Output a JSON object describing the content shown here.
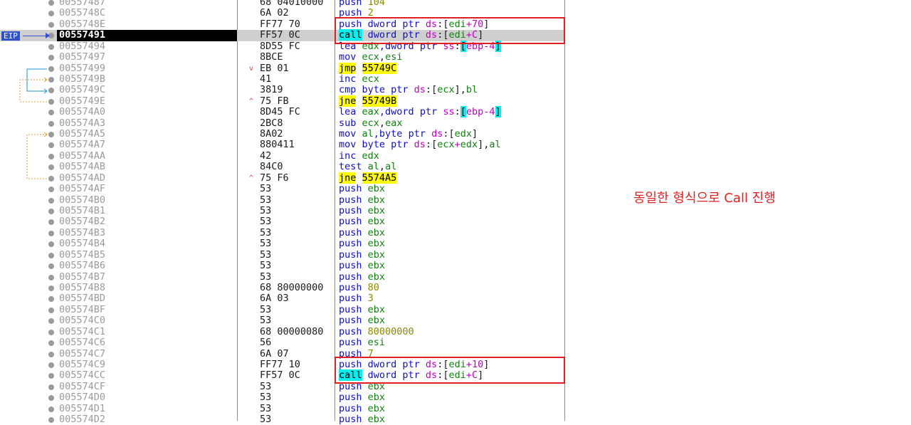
{
  "eip_label": "EIP",
  "note": "동일한 형식으로 Call 진행",
  "colors": {
    "highlight_jump": "#ffff00",
    "highlight_call": "#00f0f0",
    "annotation": "#e02020",
    "eip_marker": "#3050d0"
  },
  "rows": [
    {
      "addr": "00557487",
      "bytes": "68 04010000",
      "mark": "",
      "ins": [
        [
          "push",
          "mn"
        ],
        [
          " ",
          "plain"
        ],
        [
          "104",
          "num"
        ]
      ]
    },
    {
      "addr": "0055748C",
      "bytes": "6A 02",
      "mark": "",
      "ins": [
        [
          "push",
          "mn"
        ],
        [
          " ",
          "plain"
        ],
        [
          "2",
          "num"
        ]
      ]
    },
    {
      "addr": "0055748E",
      "bytes": "FF77 70",
      "mark": "",
      "ins": [
        [
          "push",
          "mn"
        ],
        [
          " dword ptr ",
          "mn"
        ],
        [
          "ds",
          "seg"
        ],
        [
          ":[",
          "plain"
        ],
        [
          "edi",
          "reg"
        ],
        [
          "+70",
          "seg"
        ],
        [
          "]",
          "plain"
        ]
      ]
    },
    {
      "addr": "00557491",
      "bytes": "FF57 0C",
      "mark": "",
      "eip": true,
      "ins": [
        [
          "call",
          "cyan"
        ],
        [
          " dword ptr ",
          "mn"
        ],
        [
          "ds",
          "seg"
        ],
        [
          ":[",
          "plain"
        ],
        [
          "edi",
          "reg"
        ],
        [
          "+C",
          "seg"
        ],
        [
          "]",
          "plain"
        ]
      ]
    },
    {
      "addr": "00557494",
      "bytes": "8D55 FC",
      "mark": "",
      "ins": [
        [
          "lea",
          "mn"
        ],
        [
          " ",
          "plain"
        ],
        [
          "edx",
          "reg"
        ],
        [
          ",dword ptr ",
          "mn"
        ],
        [
          "ss",
          "seg"
        ],
        [
          ":",
          "plain"
        ],
        [
          "[",
          "cyan"
        ],
        [
          "ebp-4",
          "seg"
        ],
        [
          "]",
          "cyan"
        ]
      ]
    },
    {
      "addr": "00557497",
      "bytes": "8BCE",
      "mark": "",
      "ins": [
        [
          "mov",
          "mn"
        ],
        [
          " ",
          "plain"
        ],
        [
          "ecx",
          "reg"
        ],
        [
          ",",
          "plain"
        ],
        [
          "esi",
          "reg"
        ]
      ]
    },
    {
      "addr": "00557499",
      "bytes": "EB 01",
      "mark": "v",
      "ins": [
        [
          "jmp",
          "yellow"
        ],
        [
          " ",
          "plain"
        ],
        [
          "55749C",
          "yellow"
        ]
      ]
    },
    {
      "addr": "0055749B",
      "bytes": "41",
      "mark": "",
      "ins": [
        [
          "inc",
          "mn"
        ],
        [
          " ",
          "plain"
        ],
        [
          "ecx",
          "reg"
        ]
      ]
    },
    {
      "addr": "0055749C",
      "bytes": "3819",
      "mark": "",
      "ins": [
        [
          "cmp",
          "mn"
        ],
        [
          " byte ptr ",
          "mn"
        ],
        [
          "ds",
          "seg"
        ],
        [
          ":[",
          "plain"
        ],
        [
          "ecx",
          "reg"
        ],
        [
          "],",
          "plain"
        ],
        [
          "bl",
          "reg"
        ]
      ]
    },
    {
      "addr": "0055749E",
      "bytes": "75 FB",
      "mark": "^",
      "ins": [
        [
          "jne",
          "yellow"
        ],
        [
          " ",
          "plain"
        ],
        [
          "55749B",
          "yellow"
        ]
      ]
    },
    {
      "addr": "005574A0",
      "bytes": "8D45 FC",
      "mark": "",
      "ins": [
        [
          "lea",
          "mn"
        ],
        [
          " ",
          "plain"
        ],
        [
          "eax",
          "reg"
        ],
        [
          ",dword ptr ",
          "mn"
        ],
        [
          "ss",
          "seg"
        ],
        [
          ":",
          "plain"
        ],
        [
          "[",
          "cyan"
        ],
        [
          "ebp-4",
          "seg"
        ],
        [
          "]",
          "cyan"
        ]
      ]
    },
    {
      "addr": "005574A3",
      "bytes": "2BC8",
      "mark": "",
      "ins": [
        [
          "sub",
          "mn"
        ],
        [
          " ",
          "plain"
        ],
        [
          "ecx",
          "reg"
        ],
        [
          ",",
          "plain"
        ],
        [
          "eax",
          "reg"
        ]
      ]
    },
    {
      "addr": "005574A5",
      "bytes": "8A02",
      "mark": "",
      "ins": [
        [
          "mov",
          "mn"
        ],
        [
          " ",
          "plain"
        ],
        [
          "al",
          "reg"
        ],
        [
          ",byte ptr ",
          "mn"
        ],
        [
          "ds",
          "seg"
        ],
        [
          ":[",
          "plain"
        ],
        [
          "edx",
          "reg"
        ],
        [
          "]",
          "plain"
        ]
      ]
    },
    {
      "addr": "005574A7",
      "bytes": "880411",
      "mark": "",
      "ins": [
        [
          "mov",
          "mn"
        ],
        [
          " byte ptr ",
          "mn"
        ],
        [
          "ds",
          "seg"
        ],
        [
          ":[",
          "plain"
        ],
        [
          "ecx",
          "reg"
        ],
        [
          "+",
          "seg"
        ],
        [
          "edx",
          "reg"
        ],
        [
          "],",
          "plain"
        ],
        [
          "al",
          "reg"
        ]
      ]
    },
    {
      "addr": "005574AA",
      "bytes": "42",
      "mark": "",
      "ins": [
        [
          "inc",
          "mn"
        ],
        [
          " ",
          "plain"
        ],
        [
          "edx",
          "reg"
        ]
      ]
    },
    {
      "addr": "005574AB",
      "bytes": "84C0",
      "mark": "",
      "ins": [
        [
          "test",
          "mn"
        ],
        [
          " ",
          "plain"
        ],
        [
          "al",
          "reg"
        ],
        [
          ",",
          "plain"
        ],
        [
          "al",
          "reg"
        ]
      ]
    },
    {
      "addr": "005574AD",
      "bytes": "75 F6",
      "mark": "^",
      "ins": [
        [
          "jne",
          "yellow"
        ],
        [
          " ",
          "plain"
        ],
        [
          "5574A5",
          "yellow"
        ]
      ]
    },
    {
      "addr": "005574AF",
      "bytes": "53",
      "mark": "",
      "ins": [
        [
          "push",
          "mn"
        ],
        [
          " ",
          "plain"
        ],
        [
          "ebx",
          "reg"
        ]
      ]
    },
    {
      "addr": "005574B0",
      "bytes": "53",
      "mark": "",
      "ins": [
        [
          "push",
          "mn"
        ],
        [
          " ",
          "plain"
        ],
        [
          "ebx",
          "reg"
        ]
      ]
    },
    {
      "addr": "005574B1",
      "bytes": "53",
      "mark": "",
      "ins": [
        [
          "push",
          "mn"
        ],
        [
          " ",
          "plain"
        ],
        [
          "ebx",
          "reg"
        ]
      ]
    },
    {
      "addr": "005574B2",
      "bytes": "53",
      "mark": "",
      "ins": [
        [
          "push",
          "mn"
        ],
        [
          " ",
          "plain"
        ],
        [
          "ebx",
          "reg"
        ]
      ]
    },
    {
      "addr": "005574B3",
      "bytes": "53",
      "mark": "",
      "ins": [
        [
          "push",
          "mn"
        ],
        [
          " ",
          "plain"
        ],
        [
          "ebx",
          "reg"
        ]
      ]
    },
    {
      "addr": "005574B4",
      "bytes": "53",
      "mark": "",
      "ins": [
        [
          "push",
          "mn"
        ],
        [
          " ",
          "plain"
        ],
        [
          "ebx",
          "reg"
        ]
      ]
    },
    {
      "addr": "005574B5",
      "bytes": "53",
      "mark": "",
      "ins": [
        [
          "push",
          "mn"
        ],
        [
          " ",
          "plain"
        ],
        [
          "ebx",
          "reg"
        ]
      ]
    },
    {
      "addr": "005574B6",
      "bytes": "53",
      "mark": "",
      "ins": [
        [
          "push",
          "mn"
        ],
        [
          " ",
          "plain"
        ],
        [
          "ebx",
          "reg"
        ]
      ]
    },
    {
      "addr": "005574B7",
      "bytes": "53",
      "mark": "",
      "ins": [
        [
          "push",
          "mn"
        ],
        [
          " ",
          "plain"
        ],
        [
          "ebx",
          "reg"
        ]
      ]
    },
    {
      "addr": "005574B8",
      "bytes": "68 80000000",
      "mark": "",
      "ins": [
        [
          "push",
          "mn"
        ],
        [
          " ",
          "plain"
        ],
        [
          "80",
          "num"
        ]
      ]
    },
    {
      "addr": "005574BD",
      "bytes": "6A 03",
      "mark": "",
      "ins": [
        [
          "push",
          "mn"
        ],
        [
          " ",
          "plain"
        ],
        [
          "3",
          "num"
        ]
      ]
    },
    {
      "addr": "005574BF",
      "bytes": "53",
      "mark": "",
      "ins": [
        [
          "push",
          "mn"
        ],
        [
          " ",
          "plain"
        ],
        [
          "ebx",
          "reg"
        ]
      ]
    },
    {
      "addr": "005574C0",
      "bytes": "53",
      "mark": "",
      "ins": [
        [
          "push",
          "mn"
        ],
        [
          " ",
          "plain"
        ],
        [
          "ebx",
          "reg"
        ]
      ]
    },
    {
      "addr": "005574C1",
      "bytes": "68 00000080",
      "mark": "",
      "ins": [
        [
          "push",
          "mn"
        ],
        [
          " ",
          "plain"
        ],
        [
          "80000000",
          "num"
        ]
      ]
    },
    {
      "addr": "005574C6",
      "bytes": "56",
      "mark": "",
      "ins": [
        [
          "push",
          "mn"
        ],
        [
          " ",
          "plain"
        ],
        [
          "esi",
          "reg"
        ]
      ]
    },
    {
      "addr": "005574C7",
      "bytes": "6A 07",
      "mark": "",
      "ins": [
        [
          "push",
          "mn"
        ],
        [
          " ",
          "plain"
        ],
        [
          "7",
          "num"
        ]
      ]
    },
    {
      "addr": "005574C9",
      "bytes": "FF77 10",
      "mark": "",
      "ins": [
        [
          "push",
          "mn"
        ],
        [
          " dword ptr ",
          "mn"
        ],
        [
          "ds",
          "seg"
        ],
        [
          ":[",
          "plain"
        ],
        [
          "edi",
          "reg"
        ],
        [
          "+10",
          "seg"
        ],
        [
          "]",
          "plain"
        ]
      ]
    },
    {
      "addr": "005574CC",
      "bytes": "FF57 0C",
      "mark": "",
      "ins": [
        [
          "call",
          "cyan"
        ],
        [
          " dword ptr ",
          "mn"
        ],
        [
          "ds",
          "seg"
        ],
        [
          ":[",
          "plain"
        ],
        [
          "edi",
          "reg"
        ],
        [
          "+C",
          "seg"
        ],
        [
          "]",
          "plain"
        ]
      ]
    },
    {
      "addr": "005574CF",
      "bytes": "53",
      "mark": "",
      "ins": [
        [
          "push",
          "mn"
        ],
        [
          " ",
          "plain"
        ],
        [
          "ebx",
          "reg"
        ]
      ]
    },
    {
      "addr": "005574D0",
      "bytes": "53",
      "mark": "",
      "ins": [
        [
          "push",
          "mn"
        ],
        [
          " ",
          "plain"
        ],
        [
          "ebx",
          "reg"
        ]
      ]
    },
    {
      "addr": "005574D1",
      "bytes": "53",
      "mark": "",
      "ins": [
        [
          "push",
          "mn"
        ],
        [
          " ",
          "plain"
        ],
        [
          "ebx",
          "reg"
        ]
      ]
    },
    {
      "addr": "005574D2",
      "bytes": "53",
      "mark": "",
      "ins": [
        [
          "push",
          "mn"
        ],
        [
          " ",
          "plain"
        ],
        [
          "ebx",
          "reg"
        ]
      ]
    }
  ]
}
